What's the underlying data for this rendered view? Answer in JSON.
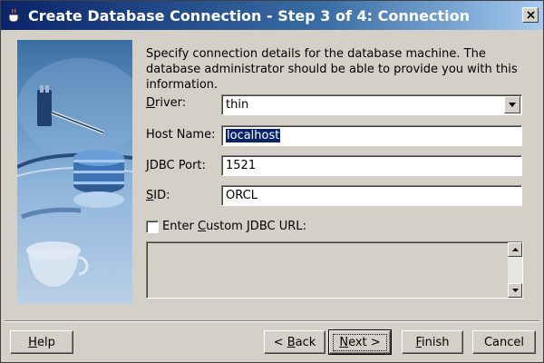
{
  "window": {
    "title": "Create Database Connection - Step 3 of 4: Connection"
  },
  "instructions": "Specify connection details for the database machine. The database administrator should be able to provide you with this information.",
  "form": {
    "driver": {
      "label_mn": "D",
      "label_rest": "river:",
      "value": "thin"
    },
    "host": {
      "label_pre": "Host Name:",
      "value": "localhost"
    },
    "port": {
      "label_mn": "J",
      "label_rest": "DBC Port:",
      "value": "1521"
    },
    "sid": {
      "label_mn": "S",
      "label_rest": "ID:",
      "value": "ORCL"
    },
    "custom_url": {
      "label_pre": "Enter ",
      "label_mn": "C",
      "label_rest": "ustom JDBC URL:",
      "checked": false,
      "value": ""
    }
  },
  "buttons": {
    "help": {
      "mn": "H",
      "rest": "elp"
    },
    "back": {
      "pre": "< ",
      "mn": "B",
      "rest": "ack"
    },
    "next": {
      "mn": "N",
      "rest": "ext >"
    },
    "finish": {
      "mn": "F",
      "rest": "inish"
    },
    "cancel": {
      "label": "Cancel"
    }
  },
  "icons": {
    "title": "coffee-cup-icon",
    "close": "close-icon",
    "dropdown": "chevron-down-icon",
    "scroll_up": "scroll-up-icon",
    "scroll_down": "scroll-down-icon"
  },
  "colors": {
    "titlebar_start": "#0a246a",
    "titlebar_end": "#a6caf0",
    "dialog_bg": "#d4d0c8",
    "selection": "#0a246a"
  }
}
